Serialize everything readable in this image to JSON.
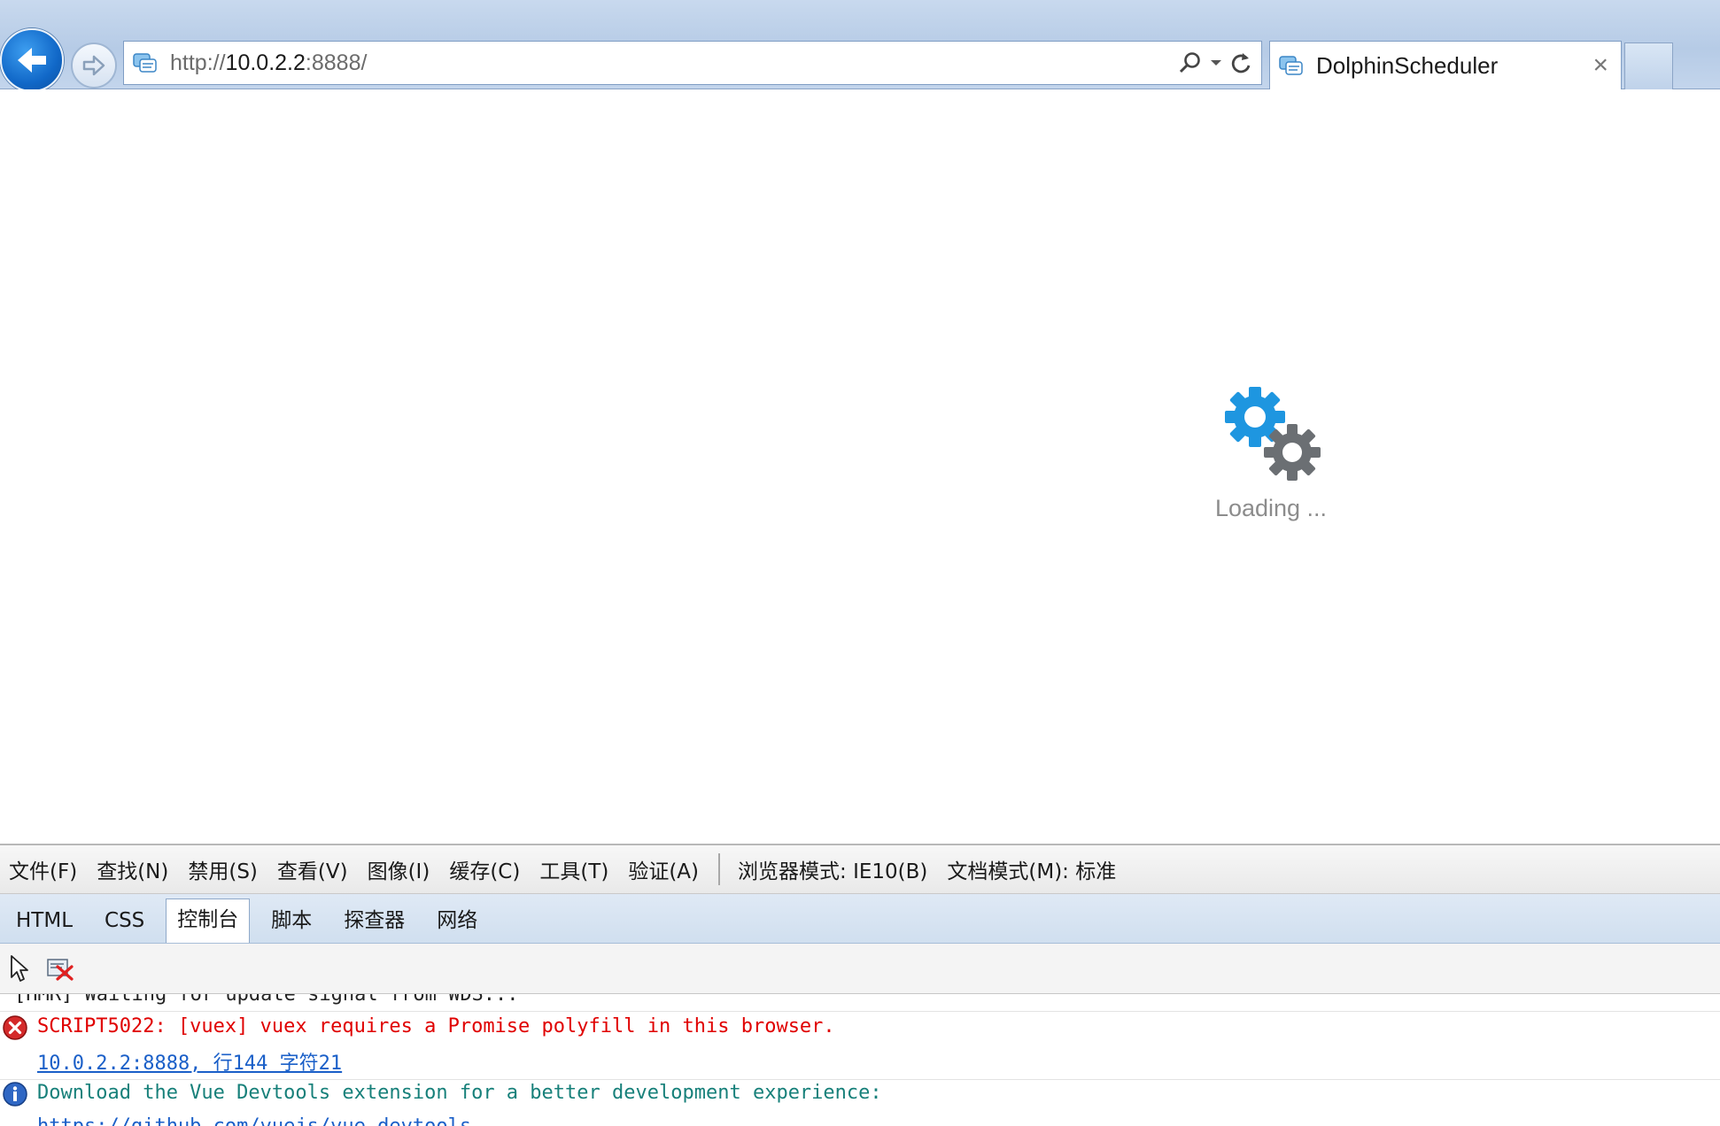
{
  "browser": {
    "address": {
      "scheme": "http://",
      "host": "10.0.2.2",
      "port_path": ":8888/"
    },
    "tab": {
      "title": "DolphinScheduler",
      "close": "×"
    }
  },
  "page": {
    "loading_text": "Loading ...",
    "gear_colors": {
      "large": "#1e96e0",
      "small": "#6b6f73"
    }
  },
  "devtools": {
    "menu": [
      "文件(F)",
      "查找(N)",
      "禁用(S)",
      "查看(V)",
      "图像(I)",
      "缓存(C)",
      "工具(T)",
      "验证(A)"
    ],
    "browser_mode": "浏览器模式: IE10(B)",
    "document_mode": "文档模式(M): 标准",
    "tabs": [
      "HTML",
      "CSS",
      "控制台",
      "脚本",
      "探查器",
      "网络"
    ],
    "active_tab": "控制台",
    "console": {
      "hmr": "[HMR] Waiting for update signal from WDS...",
      "error": "SCRIPT5022: [vuex] vuex requires a Promise polyfill in this browser.",
      "error_location": "10.0.2.2:8888, 行144 字符21",
      "info": "Download the Vue Devtools extension for a better development experience:",
      "info_url": "https://github.com/vuejs/vue-devtools"
    }
  }
}
